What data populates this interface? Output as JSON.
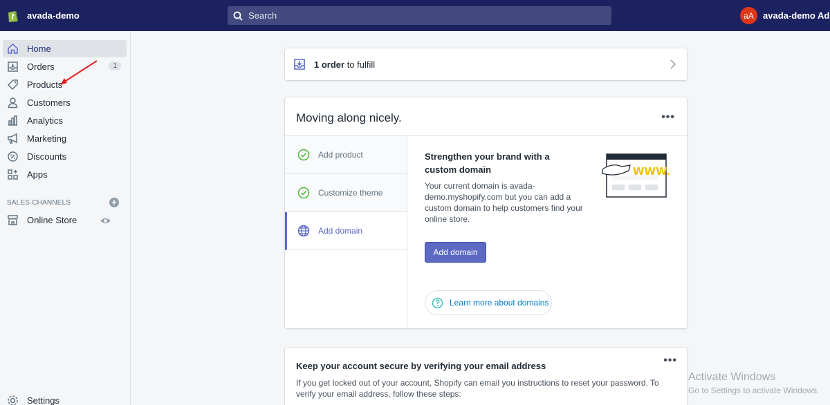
{
  "topbar": {
    "store_name": "avada-demo",
    "search_placeholder": "Search",
    "avatar_initials": "aA",
    "account_name": "avada-demo Admin"
  },
  "sidebar": {
    "items": [
      {
        "label": "Home",
        "icon": "home-icon",
        "active": true
      },
      {
        "label": "Orders",
        "icon": "orders-icon",
        "badge": "1"
      },
      {
        "label": "Products",
        "icon": "tag-icon"
      },
      {
        "label": "Customers",
        "icon": "person-icon"
      },
      {
        "label": "Analytics",
        "icon": "bar-chart-icon"
      },
      {
        "label": "Marketing",
        "icon": "megaphone-icon"
      },
      {
        "label": "Discounts",
        "icon": "discount-icon"
      },
      {
        "label": "Apps",
        "icon": "apps-icon"
      }
    ],
    "sales_channels_label": "SALES CHANNELS",
    "online_store_label": "Online Store",
    "settings_label": "Settings"
  },
  "fulfill": {
    "count_text": "1 order",
    "rest_text": " to fulfill"
  },
  "progress": {
    "title": "Moving along nicely.",
    "steps": [
      {
        "label": "Add product",
        "status": "done"
      },
      {
        "label": "Customize theme",
        "status": "done"
      },
      {
        "label": "Add domain",
        "status": "current"
      }
    ],
    "heading": "Strengthen your brand with a custom domain",
    "body": "Your current domain is avada-demo.myshopify.com but you can add a custom domain to help customers find your online store.",
    "button_label": "Add domain",
    "learn_label": "Learn more about domains"
  },
  "secure": {
    "title": "Keep your account secure by verifying your email address",
    "body": "If you get locked out of your account, Shopify can email you instructions to reset your password. To verify your email address, follow these steps:"
  },
  "watermark": {
    "line1": "Activate Windows",
    "line2": "Go to Settings to activate Windows."
  },
  "colors": {
    "topbar": "#1c2260",
    "accent": "#5c6ac4",
    "link": "#007ace",
    "success": "#50b83c",
    "annotation_arrow": "#e02020"
  }
}
